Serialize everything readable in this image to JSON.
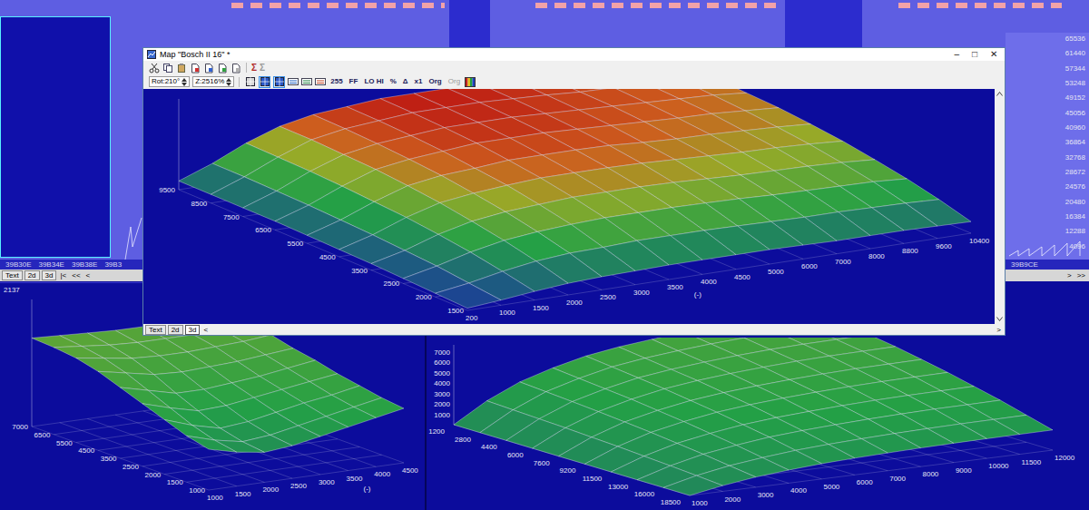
{
  "background": {
    "scale_labels": [
      "65536",
      "61440",
      "57344",
      "53248",
      "49152",
      "45056",
      "40960",
      "36864",
      "32768",
      "28672",
      "24576",
      "20480",
      "16384",
      "12288",
      "4096"
    ],
    "left_addresses": [
      "39B30E",
      "39B34E",
      "39B38E",
      "39B3"
    ],
    "right_address": "39B9CE",
    "left_tabs": [
      {
        "label": "Text",
        "selected": false
      },
      {
        "label": "2d",
        "selected": false
      },
      {
        "label": "3d",
        "selected": false
      }
    ],
    "left_nav": [
      "|<",
      "<<",
      "<"
    ],
    "right_nav": [
      ">",
      ">>"
    ]
  },
  "map_window": {
    "title": "Map \"Bosch II 16\" *",
    "controls": [
      "–",
      "□",
      "✕"
    ],
    "sum_buttons": [
      {
        "label": "Σ",
        "disabled": false
      },
      {
        "label": "Σ",
        "disabled": true
      }
    ],
    "fields": [
      "Rot:210°",
      "Z:2516%"
    ],
    "view_toggles": [
      {
        "selected": false
      },
      {
        "selected": true
      },
      {
        "selected": true
      }
    ],
    "buttons": [
      {
        "label": "255",
        "disabled": false
      },
      {
        "label": "FF",
        "disabled": false
      },
      {
        "label": "LO HI",
        "disabled": false
      },
      {
        "label": "%",
        "disabled": false
      },
      {
        "label": "Δ",
        "disabled": false
      },
      {
        "label": "x1",
        "disabled": false
      },
      {
        "label": "Org",
        "disabled": false
      },
      {
        "label": "Org",
        "disabled": true
      }
    ],
    "chart": {
      "unit": "(-)",
      "x_labels": [
        "200",
        "1000",
        "1500",
        "2000",
        "2500",
        "3000",
        "3500",
        "4000",
        "4500",
        "5000",
        "6000",
        "7000",
        "8000",
        "8800",
        "9600",
        "10400"
      ],
      "y_labels": [
        "9500",
        "8500",
        "7500",
        "6500",
        "5500",
        "4500",
        "3500",
        "2500",
        "2000",
        "1500"
      ],
      "z": [
        [
          3,
          7,
          12,
          16,
          18,
          19,
          20,
          20,
          20,
          20,
          19,
          18,
          18,
          18,
          17,
          16
        ],
        [
          5,
          12,
          21,
          28,
          32,
          33,
          35,
          35,
          35,
          34,
          33,
          32,
          32,
          31,
          30,
          28
        ],
        [
          7,
          17,
          29,
          38,
          43,
          46,
          48,
          48,
          48,
          47,
          46,
          44,
          43,
          42,
          41,
          38
        ],
        [
          9,
          20,
          35,
          46,
          52,
          55,
          58,
          58,
          58,
          57,
          55,
          53,
          52,
          51,
          49,
          46
        ],
        [
          10,
          23,
          40,
          53,
          59,
          63,
          66,
          66,
          66,
          65,
          63,
          61,
          59,
          58,
          56,
          53
        ],
        [
          11,
          25,
          43,
          58,
          65,
          68,
          72,
          72,
          72,
          71,
          68,
          66,
          65,
          63,
          61,
          58
        ],
        [
          12,
          27,
          46,
          62,
          69,
          73,
          77,
          77,
          77,
          75,
          73,
          71,
          69,
          68,
          65,
          62
        ],
        [
          12,
          28,
          48,
          64,
          72,
          76,
          80,
          80,
          80,
          78,
          76,
          74,
          72,
          70,
          68,
          64
        ],
        [
          12,
          29,
          49,
          66,
          74,
          78,
          82,
          82,
          82,
          80,
          78,
          75,
          74,
          72,
          70,
          66
        ],
        [
          12,
          29,
          50,
          66,
          75,
          79,
          83,
          83,
          83,
          81,
          79,
          76,
          75,
          73,
          71,
          66
        ]
      ]
    },
    "tabs": [
      {
        "label": "Text",
        "selected": false
      },
      {
        "label": "2d",
        "selected": false
      },
      {
        "label": "3d",
        "selected": true
      }
    ],
    "nav": [
      "<",
      ">"
    ]
  },
  "lower_left_map": {
    "z_max_label": "2137",
    "unit": "(-)",
    "x_labels": [
      "1000",
      "1500",
      "2000",
      "2500",
      "3000",
      "3500",
      "4000",
      "4500"
    ],
    "y_labels": [
      "7000",
      "6500",
      "5500",
      "4500",
      "3500",
      "2500",
      "2000",
      "1500",
      "1000"
    ],
    "z": [
      [
        30,
        25,
        22,
        24,
        28,
        32,
        36,
        40
      ],
      [
        34,
        28,
        24,
        26,
        30,
        34,
        38,
        42
      ],
      [
        40,
        33,
        28,
        30,
        34,
        38,
        41,
        45
      ],
      [
        46,
        40,
        35,
        36,
        39,
        42,
        45,
        48
      ],
      [
        52,
        47,
        42,
        42,
        44,
        46,
        49,
        52
      ],
      [
        58,
        54,
        50,
        49,
        50,
        51,
        53,
        55
      ],
      [
        62,
        59,
        56,
        55,
        55,
        56,
        57,
        59
      ],
      [
        64,
        62,
        60,
        59,
        59,
        59,
        60,
        61
      ],
      [
        65,
        64,
        63,
        62,
        62,
        62,
        62,
        63
      ]
    ]
  },
  "lower_right_map": {
    "z_ticks": [
      "7000",
      "6000",
      "5000",
      "4000",
      "3000",
      "2000",
      "1000"
    ],
    "row_labels": [
      "1200",
      "2800",
      "4400",
      "6000",
      "7600",
      "9200",
      "11500",
      "13000",
      "16000",
      "18500"
    ],
    "col_labels": [
      "1000",
      "2000",
      "3000",
      "4000",
      "5000",
      "6000",
      "7000",
      "8000",
      "9000",
      "10000",
      "11500",
      "12000"
    ],
    "z": [
      [
        0,
        560,
        980,
        1260,
        1480,
        1620,
        1720,
        1800,
        1860,
        1900,
        1920,
        1940
      ],
      [
        0,
        760,
        1320,
        1700,
        2000,
        2190,
        2320,
        2430,
        2510,
        2570,
        2590,
        2620
      ],
      [
        0,
        950,
        1670,
        2140,
        2520,
        2750,
        2920,
        3060,
        3160,
        3230,
        3260,
        3300
      ],
      [
        0,
        1120,
        1960,
        2520,
        2960,
        3240,
        3440,
        3600,
        3720,
        3800,
        3840,
        3880
      ],
      [
        0,
        1290,
        2250,
        2900,
        3400,
        3730,
        3960,
        4140,
        4280,
        4370,
        4420,
        4460
      ],
      [
        0,
        1430,
        2500,
        3210,
        3770,
        4130,
        4390,
        4590,
        4740,
        4850,
        4900,
        4950
      ],
      [
        0,
        1570,
        2740,
        3530,
        4140,
        4540,
        4820,
        5040,
        5210,
        5320,
        5380,
        5430
      ],
      [
        0,
        1680,
        2940,
        3780,
        4440,
        4860,
        5160,
        5400,
        5580,
        5700,
        5760,
        5820
      ],
      [
        0,
        1790,
        3140,
        4030,
        4740,
        5180,
        5500,
        5760,
        5950,
        6080,
        6140,
        6210
      ],
      [
        0,
        1900,
        3330,
        4280,
        5030,
        5510,
        5850,
        6120,
        6320,
        6460,
        6530,
        6600
      ]
    ]
  }
}
